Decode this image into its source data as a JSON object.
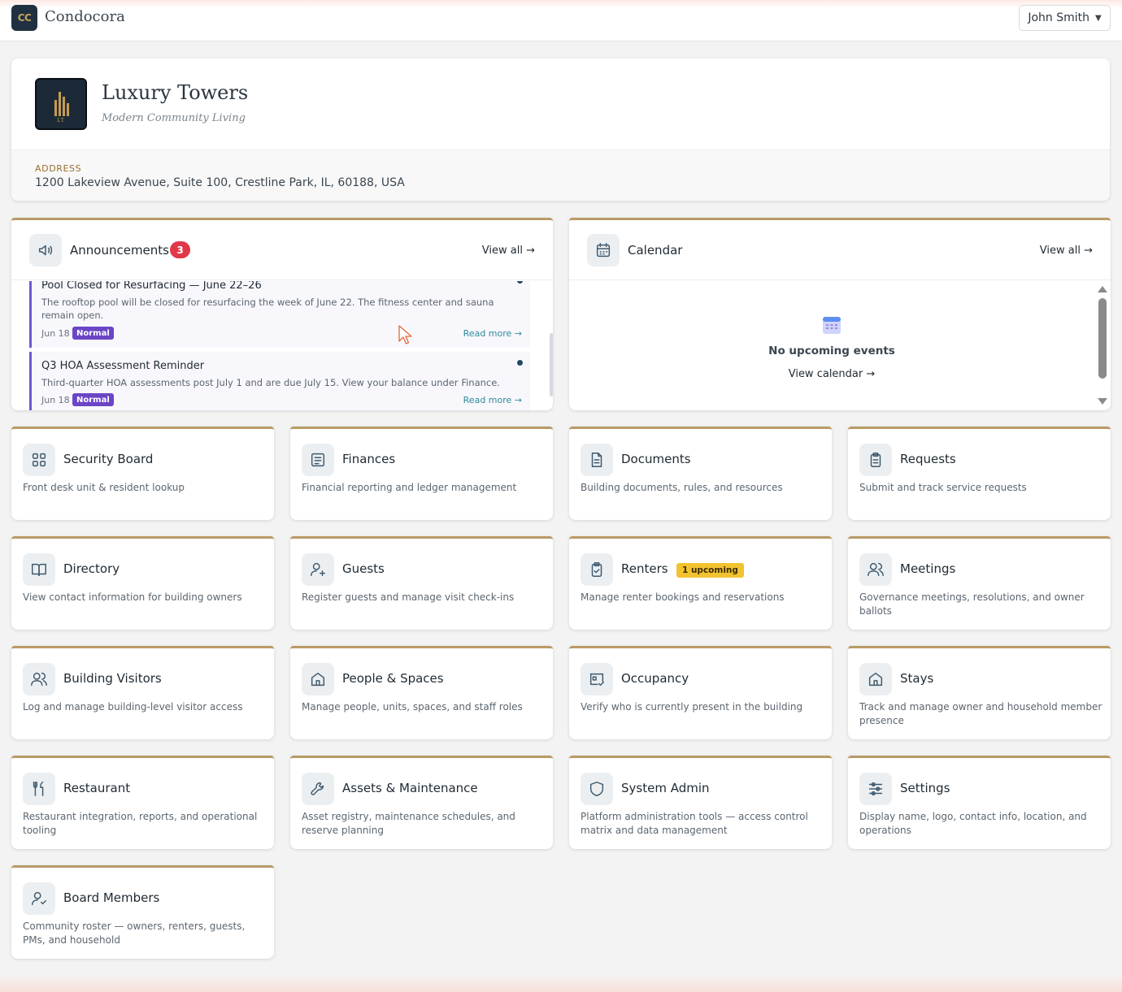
{
  "topbar": {
    "logo_text": "CC",
    "brand": "Condocora",
    "user_name": "John Smith",
    "user_caret": "▼"
  },
  "community": {
    "name": "Luxury Towers",
    "tagline": "Modern Community Living",
    "logo_monogram": "LT",
    "address_label": "ADDRESS",
    "address": "1200 Lakeview Avenue, Suite 100, Crestline Park, IL, 60188, USA"
  },
  "announcements": {
    "title": "Announcements",
    "count": "3",
    "view_all": "View all →",
    "items": [
      {
        "title": "Pool Closed for Resurfacing — June 22–26",
        "body": "The rooftop pool will be closed for resurfacing the week of June 22. The fitness center and sauna remain open.",
        "date": "Jun 18",
        "priority": "Normal",
        "read_more": "Read more →"
      },
      {
        "title": "Q3 HOA Assessment Reminder",
        "body": "Third-quarter HOA assessments post July 1 and are due July 15. View your balance under Finance.",
        "date": "Jun 18",
        "priority": "Normal",
        "read_more": "Read more →"
      }
    ]
  },
  "calendar": {
    "title": "Calendar",
    "view_all": "View all →",
    "empty_title": "No upcoming events",
    "view_calendar": "View calendar →"
  },
  "modules": [
    {
      "title": "Security Board",
      "desc": "Front desk unit & resident lookup",
      "icon": "grid-icon"
    },
    {
      "title": "Finances",
      "desc": "Financial reporting and ledger management",
      "icon": "ledger-icon"
    },
    {
      "title": "Documents",
      "desc": "Building documents, rules, and resources",
      "icon": "document-icon"
    },
    {
      "title": "Requests",
      "desc": "Submit and track service requests",
      "icon": "clipboard-icon"
    },
    {
      "title": "Directory",
      "desc": "View contact information for building owners",
      "icon": "book-icon"
    },
    {
      "title": "Guests",
      "desc": "Register guests and manage visit check-ins",
      "icon": "user-plus-icon"
    },
    {
      "title": "Renters",
      "desc": "Manage renter bookings and reservations",
      "icon": "clipboard-check-icon",
      "badge": "1 upcoming"
    },
    {
      "title": "Meetings",
      "desc": "Governance meetings, resolutions, and owner ballots",
      "icon": "users-icon"
    },
    {
      "title": "Building Visitors",
      "desc": "Log and manage building-level visitor access",
      "icon": "users-icon"
    },
    {
      "title": "People & Spaces",
      "desc": "Manage people, units, spaces, and staff roles",
      "icon": "home-icon"
    },
    {
      "title": "Occupancy",
      "desc": "Verify who is currently present in the building",
      "icon": "id-check-icon"
    },
    {
      "title": "Stays",
      "desc": "Track and manage owner and household member presence",
      "icon": "home-icon"
    },
    {
      "title": "Restaurant",
      "desc": "Restaurant integration, reports, and operational tooling",
      "icon": "utensils-icon"
    },
    {
      "title": "Assets & Maintenance",
      "desc": "Asset registry, maintenance schedules, and reserve planning",
      "icon": "wrench-icon"
    },
    {
      "title": "System Admin",
      "desc": "Platform administration tools — access control matrix and data management",
      "icon": "shield-icon"
    },
    {
      "title": "Settings",
      "desc": "Display name, logo, contact info, location, and operations",
      "icon": "sliders-icon"
    },
    {
      "title": "Board Members",
      "desc": "Community roster — owners, renters, guests, PMs, and household",
      "icon": "user-check-icon"
    }
  ]
}
